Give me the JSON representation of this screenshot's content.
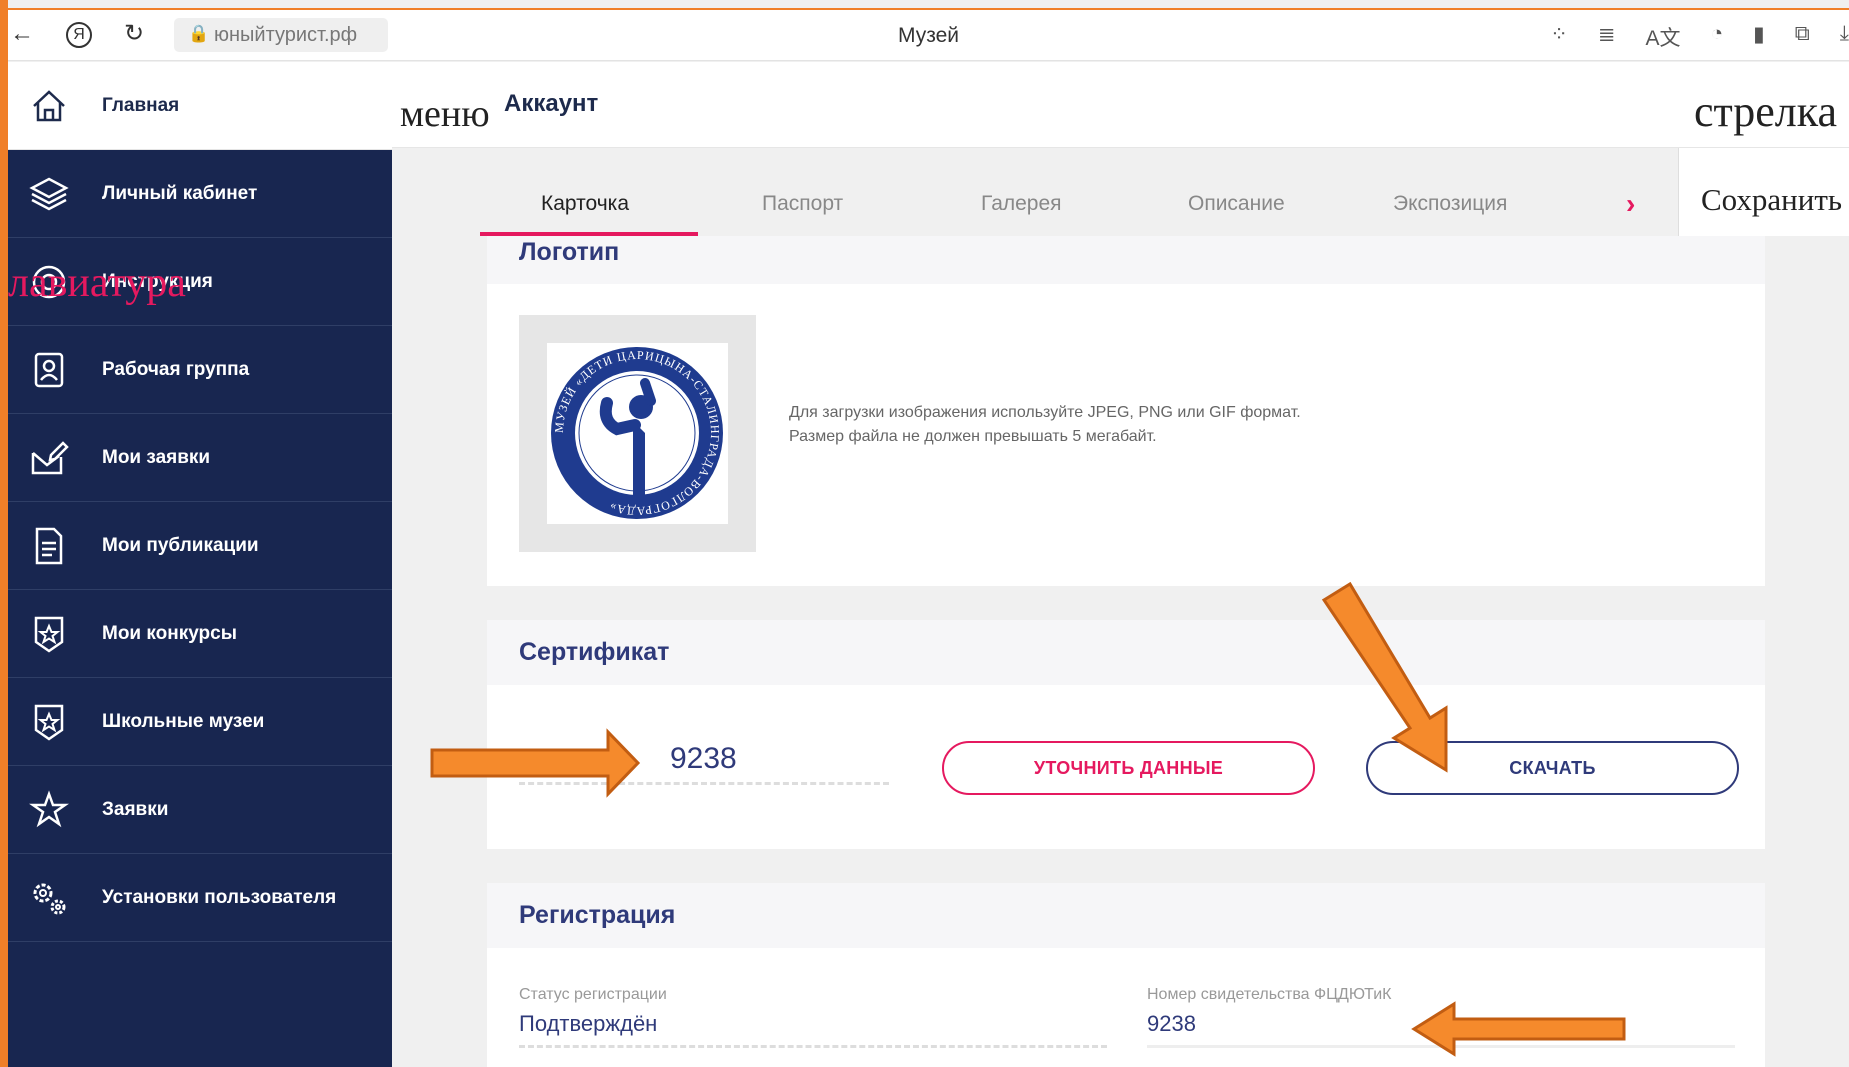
{
  "browser": {
    "url": "юныйтурист.рф",
    "tab_title": "Музей"
  },
  "sidebar": {
    "items": [
      {
        "label": "Главная",
        "icon": "home-icon"
      },
      {
        "label": "Личный кабинет",
        "icon": "layers-icon"
      },
      {
        "label": "Инструкция",
        "icon": "lifebuoy-icon"
      },
      {
        "label": "Рабочая группа",
        "icon": "badge-icon"
      },
      {
        "label": "Мои заявки",
        "icon": "envelope-edit-icon"
      },
      {
        "label": "Мои публикации",
        "icon": "document-icon"
      },
      {
        "label": "Мои конкурсы",
        "icon": "star-shield-icon"
      },
      {
        "label": "Школьные музеи",
        "icon": "star-shield-icon"
      },
      {
        "label": "Заявки",
        "icon": "star-burst-icon"
      },
      {
        "label": "Установки пользователя",
        "icon": "gears-icon"
      }
    ]
  },
  "annotations": {
    "keyboard_overlay": "лавиатура",
    "menu": "меню",
    "arrow": "стрелка"
  },
  "header": {
    "title": "Аккаунт"
  },
  "tabs": [
    "Карточка",
    "Паспорт",
    "Галерея",
    "Описание",
    "Экспозиция"
  ],
  "save_label": "Сохранить",
  "logo_section": {
    "title": "Логотип",
    "hint_line1": "Для загрузки изображения используйте JPEG, PNG или GIF формат.",
    "hint_line2": "Размер файла не должен превышать 5 мегабайт.",
    "logo_ring_text": "МУЗЕЙ «ДЕТИ ЦАРИЦЫНА-СТАЛИНГРАДА-ВОЛГОГРАДА»"
  },
  "certificate": {
    "title": "Сертификат",
    "number": "9238",
    "clarify_button": "УТОЧНИТЬ ДАННЫЕ",
    "download_button": "СКАЧАТЬ"
  },
  "registration": {
    "title": "Регистрация",
    "status_label": "Статус регистрации",
    "status_value": "Подтверждён",
    "cert_label": "Номер свидетельства ФЦДЮТиК",
    "cert_value": "9238"
  },
  "colors": {
    "sidebar": "#182650",
    "accent": "#e5195f",
    "navy": "#2f3a7a",
    "arrow": "#f07f28"
  }
}
